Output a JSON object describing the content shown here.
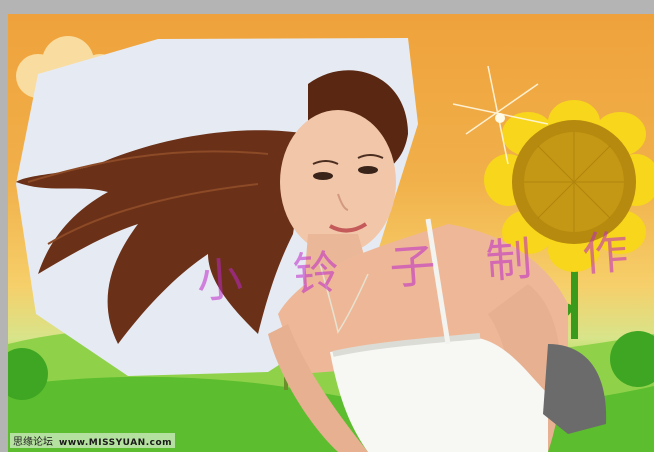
{
  "image": {
    "subject": "woman-with-windblown-hair",
    "background": "cartoon-sunflower-meadow"
  },
  "watermark": {
    "text": "小 铃 子 制 作"
  },
  "credit": {
    "forum": "思缘论坛",
    "site": "www.MISSYUAN.com"
  },
  "colors": {
    "sky": "#efa23c",
    "grass": "#6cc63a",
    "petal": "#f7d61c",
    "flower_center": "#b58a0e",
    "watermark": "#be28c8"
  }
}
